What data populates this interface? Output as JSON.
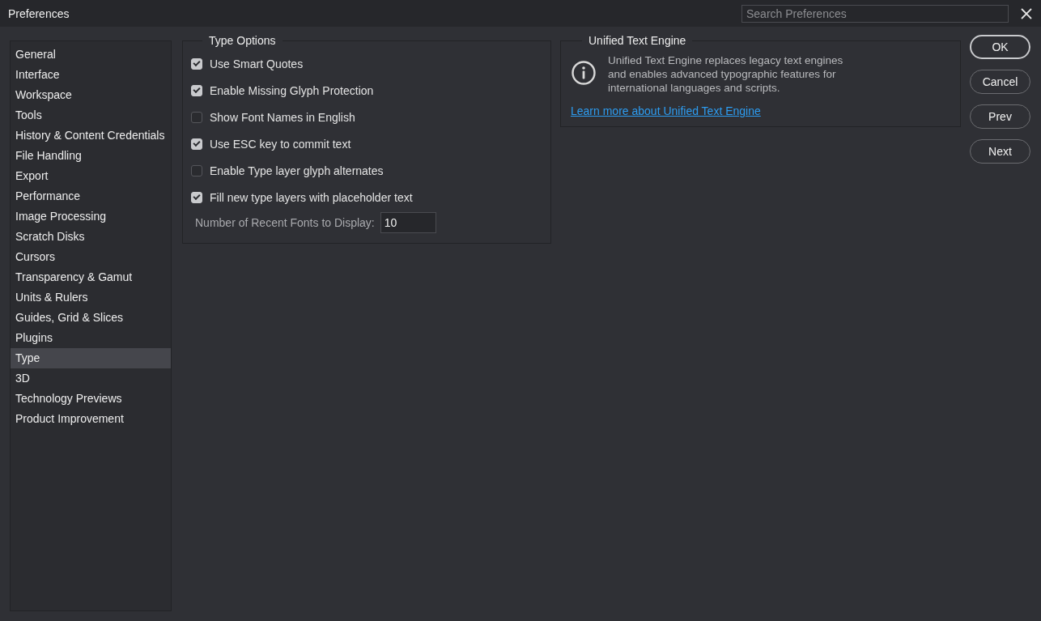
{
  "window": {
    "title": "Preferences"
  },
  "search": {
    "placeholder": "Search Preferences"
  },
  "sidebar": {
    "items": [
      {
        "label": "General",
        "selected": false
      },
      {
        "label": "Interface",
        "selected": false
      },
      {
        "label": "Workspace",
        "selected": false
      },
      {
        "label": "Tools",
        "selected": false
      },
      {
        "label": "History & Content Credentials",
        "selected": false
      },
      {
        "label": "File Handling",
        "selected": false
      },
      {
        "label": "Export",
        "selected": false
      },
      {
        "label": "Performance",
        "selected": false
      },
      {
        "label": "Image Processing",
        "selected": false
      },
      {
        "label": "Scratch Disks",
        "selected": false
      },
      {
        "label": "Cursors",
        "selected": false
      },
      {
        "label": "Transparency & Gamut",
        "selected": false
      },
      {
        "label": "Units & Rulers",
        "selected": false
      },
      {
        "label": "Guides, Grid & Slices",
        "selected": false
      },
      {
        "label": "Plugins",
        "selected": false
      },
      {
        "label": "Type",
        "selected": true
      },
      {
        "label": "3D",
        "selected": false
      },
      {
        "label": "Technology Previews",
        "selected": false
      },
      {
        "label": "Product Improvement",
        "selected": false
      }
    ]
  },
  "type_options": {
    "title": "Type Options",
    "options": [
      {
        "label": "Use Smart Quotes",
        "checked": true
      },
      {
        "label": "Enable Missing Glyph Protection",
        "checked": true
      },
      {
        "label": "Show Font Names in English",
        "checked": false
      },
      {
        "label": "Use ESC key to commit text",
        "checked": true
      },
      {
        "label": "Enable Type layer glyph alternates",
        "checked": false
      },
      {
        "label": "Fill new type layers with placeholder text",
        "checked": true
      }
    ],
    "recent_fonts": {
      "label": "Number of Recent Fonts to Display:",
      "value": "10"
    }
  },
  "unified_text_engine": {
    "title": "Unified Text Engine",
    "description": "Unified Text Engine replaces legacy text engines and enables advanced typographic features for international languages and scripts.",
    "link": "Learn more about Unified Text Engine"
  },
  "buttons": [
    "OK",
    "Cancel",
    "Prev",
    "Next"
  ]
}
